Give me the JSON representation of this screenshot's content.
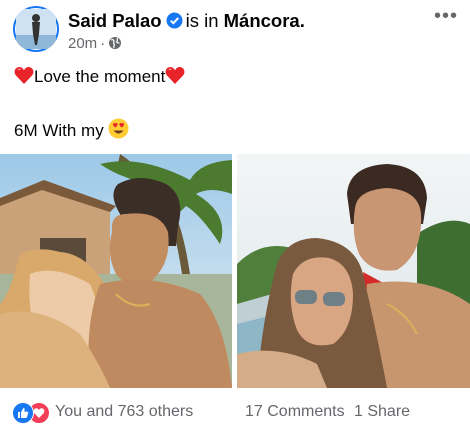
{
  "post": {
    "author": "Said Palao",
    "is_in": "is in",
    "location": "Máncora.",
    "time": "20m",
    "dot": "·",
    "more": "•••",
    "text_line1": "Love the moment",
    "text_line2": "6M With my"
  },
  "footer": {
    "reactions": "You and 763 others",
    "comments": "17 Comments",
    "shares": "1 Share"
  },
  "colors": {
    "verified": "#1877f2",
    "like": "#1877f2",
    "love": "#f33e58",
    "muted": "#65676b"
  },
  "icons": [
    "verified-badge-icon",
    "globe-icon",
    "more-icon",
    "heart-emoji-icon",
    "heart-eyes-emoji-icon",
    "like-reaction-icon",
    "love-reaction-icon"
  ]
}
